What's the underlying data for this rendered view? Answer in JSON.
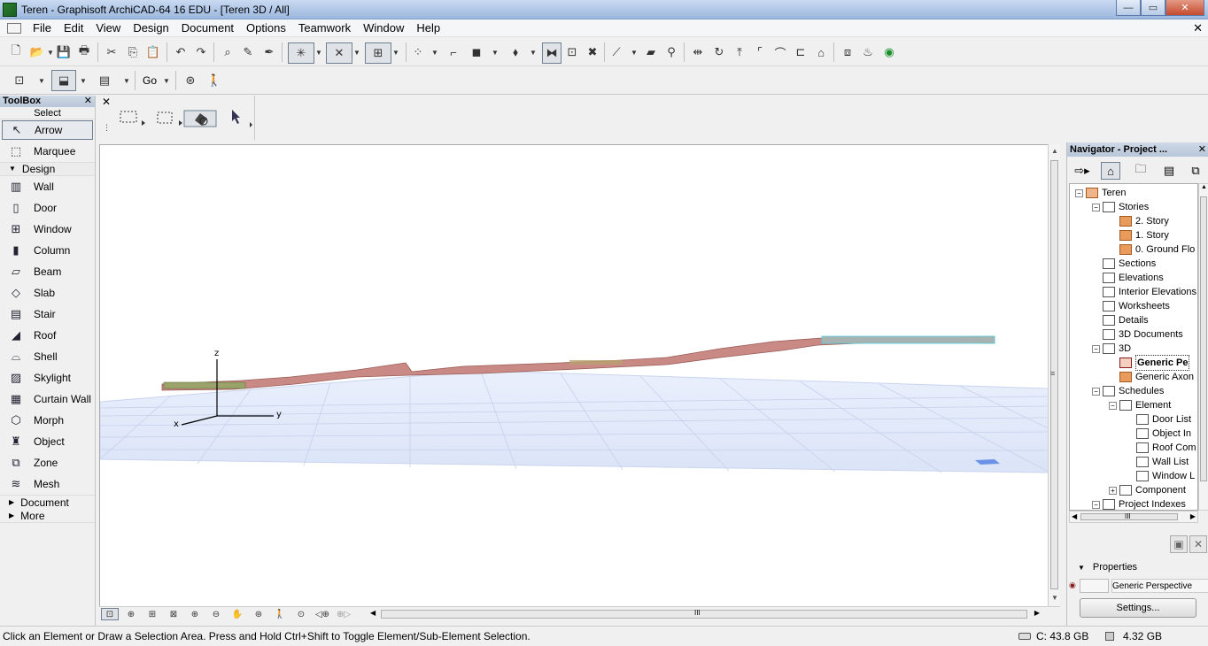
{
  "window": {
    "title": "Teren - Graphisoft ArchiCAD-64 16 EDU - [Teren 3D / All]",
    "minimize_glyph": "—",
    "maximize_glyph": "▭",
    "close_glyph": "✕"
  },
  "menu": {
    "items": [
      "File",
      "Edit",
      "View",
      "Design",
      "Document",
      "Options",
      "Teamwork",
      "Window",
      "Help"
    ],
    "close_glyph": "✕"
  },
  "toolbar": {
    "go_label": "Go"
  },
  "toolbox": {
    "title": "ToolBox",
    "close_glyph": "✕",
    "select_label": "Select",
    "select_tools": [
      {
        "label": "Arrow",
        "icon": "arrow-icon",
        "glyph": "↖"
      },
      {
        "label": "Marquee",
        "icon": "marquee-icon",
        "glyph": "⬚"
      }
    ],
    "design_label": "Design",
    "design_tools": [
      {
        "label": "Wall",
        "icon": "wall-icon",
        "glyph": "▥"
      },
      {
        "label": "Door",
        "icon": "door-icon",
        "glyph": "▯"
      },
      {
        "label": "Window",
        "icon": "window-icon",
        "glyph": "⊞"
      },
      {
        "label": "Column",
        "icon": "column-icon",
        "glyph": "▮"
      },
      {
        "label": "Beam",
        "icon": "beam-icon",
        "glyph": "▱"
      },
      {
        "label": "Slab",
        "icon": "slab-icon",
        "glyph": "◇"
      },
      {
        "label": "Stair",
        "icon": "stair-icon",
        "glyph": "▤"
      },
      {
        "label": "Roof",
        "icon": "roof-icon",
        "glyph": "◢"
      },
      {
        "label": "Shell",
        "icon": "shell-icon",
        "glyph": "⌓"
      },
      {
        "label": "Skylight",
        "icon": "skylight-icon",
        "glyph": "▨"
      },
      {
        "label": "Curtain Wall",
        "icon": "curtain-wall-icon",
        "glyph": "▦"
      },
      {
        "label": "Morph",
        "icon": "morph-icon",
        "glyph": "⬡"
      },
      {
        "label": "Object",
        "icon": "object-icon",
        "glyph": "♜"
      },
      {
        "label": "Zone",
        "icon": "zone-icon",
        "glyph": "⧉"
      },
      {
        "label": "Mesh",
        "icon": "mesh-icon",
        "glyph": "≋"
      }
    ],
    "document_label": "Document",
    "more_label": "More"
  },
  "infobox": {
    "close_glyph": "✕",
    "handle_glyph": "⋮"
  },
  "viewport": {
    "axis_labels": {
      "z": "z",
      "y": "y",
      "x": "x"
    },
    "scroll_up": "▲",
    "scroll_down": "▼",
    "scroll_left": "◀",
    "scroll_right": "▶",
    "grip": "III"
  },
  "navigator": {
    "title": "Navigator - Project ...",
    "close_glyph": "✕",
    "tree": [
      {
        "label": "Teren",
        "depth": 0,
        "toggle": "−",
        "icon": "house-icon",
        "kind": "house"
      },
      {
        "label": "Stories",
        "depth": 1,
        "toggle": "−",
        "icon": "stories-icon",
        "kind": "box"
      },
      {
        "label": "2. Story",
        "depth": 2,
        "toggle": "",
        "icon": "story-icon",
        "kind": "story"
      },
      {
        "label": "1. Story",
        "depth": 2,
        "toggle": "",
        "icon": "story-icon",
        "kind": "story"
      },
      {
        "label": "0. Ground Flo",
        "depth": 2,
        "toggle": "",
        "icon": "story-icon",
        "kind": "story"
      },
      {
        "label": "Sections",
        "depth": 1,
        "toggle": "",
        "icon": "sections-icon",
        "kind": "box"
      },
      {
        "label": "Elevations",
        "depth": 1,
        "toggle": "",
        "icon": "elevations-icon",
        "kind": "box"
      },
      {
        "label": "Interior Elevations",
        "depth": 1,
        "toggle": "",
        "icon": "interior-elevations-icon",
        "kind": "box"
      },
      {
        "label": "Worksheets",
        "depth": 1,
        "toggle": "",
        "icon": "worksheets-icon",
        "kind": "box"
      },
      {
        "label": "Details",
        "depth": 1,
        "toggle": "",
        "icon": "details-icon",
        "kind": "box"
      },
      {
        "label": "3D Documents",
        "depth": 1,
        "toggle": "",
        "icon": "3d-documents-icon",
        "kind": "box"
      },
      {
        "label": "3D",
        "depth": 1,
        "toggle": "−",
        "icon": "3d-icon",
        "kind": "box"
      },
      {
        "label": "Generic Pe",
        "depth": 2,
        "toggle": "",
        "icon": "camera-icon",
        "kind": "cam",
        "selected": true
      },
      {
        "label": "Generic Axon",
        "depth": 2,
        "toggle": "",
        "icon": "axon-icon",
        "kind": "story"
      },
      {
        "label": "Schedules",
        "depth": 1,
        "toggle": "−",
        "icon": "schedules-icon",
        "kind": "box"
      },
      {
        "label": "Element",
        "depth": 2,
        "toggle": "−",
        "icon": "element-icon",
        "kind": "box"
      },
      {
        "label": "Door List",
        "depth": 3,
        "toggle": "",
        "icon": "list-icon",
        "kind": "box"
      },
      {
        "label": "Object In",
        "depth": 3,
        "toggle": "",
        "icon": "list-icon",
        "kind": "box"
      },
      {
        "label": "Roof Com",
        "depth": 3,
        "toggle": "",
        "icon": "list-icon",
        "kind": "box"
      },
      {
        "label": "Wall List",
        "depth": 3,
        "toggle": "",
        "icon": "list-icon",
        "kind": "box"
      },
      {
        "label": "Window L",
        "depth": 3,
        "toggle": "",
        "icon": "list-icon",
        "kind": "box"
      },
      {
        "label": "Component",
        "depth": 2,
        "toggle": "+",
        "icon": "component-icon",
        "kind": "box"
      },
      {
        "label": "Project Indexes",
        "depth": 1,
        "toggle": "−",
        "icon": "project-indexes-icon",
        "kind": "box"
      }
    ],
    "properties_label": "Properties",
    "properties_value": "Generic Perspective",
    "settings_label": "Settings..."
  },
  "status": {
    "message": "Click an Element or Draw a Selection Area. Press and Hold Ctrl+Shift to Toggle Element/Sub-Element Selection.",
    "disk": "C: 43.8 GB",
    "ram": "4.32 GB"
  }
}
